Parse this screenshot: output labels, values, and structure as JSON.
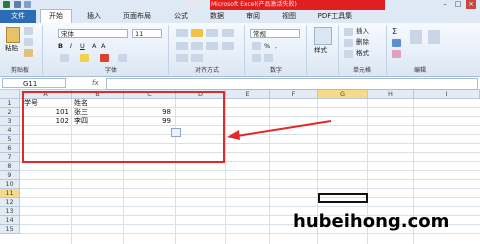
{
  "window": {
    "title": "工作簿1 - Microsoft Excel(产品激活失败)"
  },
  "tabs": [
    {
      "label": "文件"
    },
    {
      "label": "开始"
    },
    {
      "label": "插入"
    },
    {
      "label": "页面布局"
    },
    {
      "label": "公式"
    },
    {
      "label": "数据"
    },
    {
      "label": "审阅"
    },
    {
      "label": "视图"
    },
    {
      "label": "PDF工具集"
    }
  ],
  "ribbon": {
    "clipboard": {
      "paste_label": "粘贴",
      "group_label": "剪贴板"
    },
    "font": {
      "font_name": "宋体",
      "font_size": "11",
      "group_label": "字体"
    },
    "alignment": {
      "group_label": "对齐方式"
    },
    "number": {
      "format": "常规",
      "group_label": "数字"
    },
    "styles": {
      "styles_label": "样式"
    },
    "cells": {
      "insert_label": "插入",
      "delete_label": "删除",
      "format_label": "格式",
      "group_label": "单元格"
    },
    "editing": {
      "group_label": "编辑"
    }
  },
  "formula_bar": {
    "name_box": "G11",
    "fx_label": "fx",
    "formula": ""
  },
  "columns": [
    "A",
    "B",
    "C",
    "D",
    "E",
    "F",
    "G",
    "H",
    "I"
  ],
  "rows": [
    "1",
    "2",
    "3",
    "4",
    "5",
    "6",
    "7",
    "8",
    "9",
    "10",
    "11",
    "12",
    "13",
    "14",
    "15"
  ],
  "cells": {
    "A1": "学号",
    "B1": "姓名",
    "A2": "101",
    "B2": "张三",
    "C2": "98",
    "A3": "102",
    "B3": "李四",
    "C3": "99"
  },
  "active_cell": "G11",
  "watermark": "hubeihong.com",
  "colors": {
    "file_tab": "#2c6cb5",
    "annotation": "#e02a2a",
    "title_highlight": "#e02020"
  }
}
